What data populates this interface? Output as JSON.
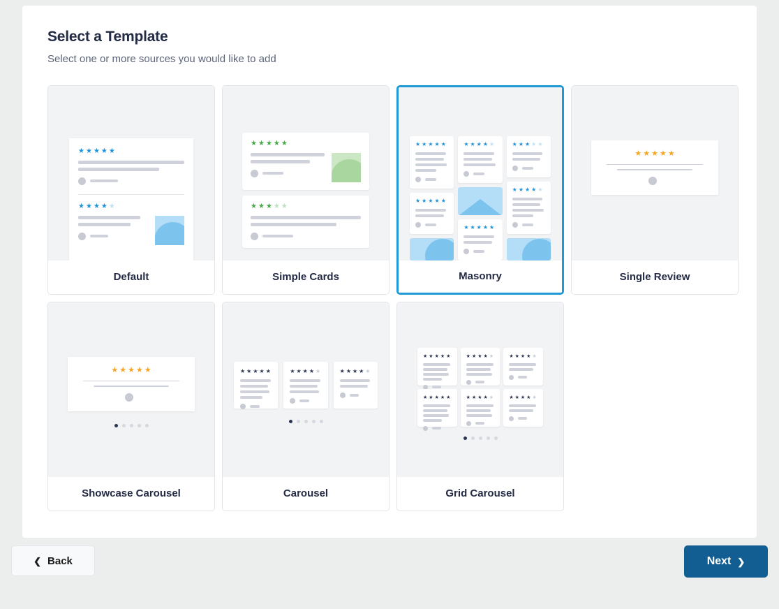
{
  "header": {
    "title": "Select a Template",
    "subtitle": "Select one or more sources you would like to add"
  },
  "colors": {
    "page_background": "#eceded",
    "panel_background": "#ffffff",
    "selected_border": "#1f9ad6",
    "title_text": "#232b45",
    "subtitle_text": "#5b6479",
    "star_blue": "#1f93d8",
    "star_blue_empty": "#bfe2f5",
    "star_green": "#46a846",
    "star_green_empty": "#bfe0bf",
    "star_gold": "#f5a623",
    "star_navy": "#2b3450",
    "star_navy_empty": "#c9ccd4",
    "skeleton_line": "#cfd2da",
    "preview_background": "#f2f3f5",
    "image_blue": "#b4ddf7",
    "image_blue_dark": "#7cc4ee",
    "image_green": "#cbe7c4",
    "image_green_dark": "#a9d69f",
    "next_button": "#125e92",
    "back_button": "#f8f9fa"
  },
  "templates": [
    {
      "id": "default",
      "label": "Default",
      "selected": false,
      "preview": {
        "style": "default",
        "star_color": "blue",
        "reviews": [
          {
            "rating": 5,
            "max": 5,
            "lines": 2,
            "has_image": false
          },
          {
            "rating": 4,
            "max": 5,
            "lines": 2,
            "has_image": true
          }
        ]
      }
    },
    {
      "id": "simple-cards",
      "label": "Simple Cards",
      "selected": false,
      "preview": {
        "style": "simple-cards",
        "star_color": "green",
        "reviews": [
          {
            "rating": 5,
            "max": 5,
            "lines": 2,
            "has_image": true
          },
          {
            "rating": 3,
            "max": 5,
            "lines": 2,
            "has_image": false
          }
        ]
      }
    },
    {
      "id": "masonry",
      "label": "Masonry",
      "selected": true,
      "preview": {
        "style": "masonry",
        "star_color": "blue",
        "columns": [
          [
            {
              "type": "review",
              "rating": 5,
              "max": 5,
              "lines": 4
            },
            {
              "type": "review",
              "rating": 5,
              "max": 5,
              "lines": 2
            },
            {
              "type": "image",
              "shape": "arc"
            }
          ],
          [
            {
              "type": "review",
              "rating": 4,
              "max": 5,
              "lines": 3
            },
            {
              "type": "image",
              "shape": "mountain"
            },
            {
              "type": "review",
              "rating": 5,
              "max": 5,
              "lines": 2
            }
          ],
          [
            {
              "type": "review",
              "rating": 3,
              "max": 5,
              "lines": 2
            },
            {
              "type": "review",
              "rating": 4,
              "max": 5,
              "lines": 4
            },
            {
              "type": "image",
              "shape": "arc"
            }
          ]
        ]
      }
    },
    {
      "id": "single-review",
      "label": "Single Review",
      "selected": false,
      "preview": {
        "style": "single-review",
        "star_color": "gold",
        "reviews": [
          {
            "rating": 5,
            "max": 5,
            "lines": 2,
            "has_image": false
          }
        ]
      }
    },
    {
      "id": "showcase-carousel",
      "label": "Showcase Carousel",
      "selected": false,
      "preview": {
        "style": "showcase-carousel",
        "star_color": "gold",
        "reviews": [
          {
            "rating": 5,
            "max": 5,
            "lines": 2,
            "has_image": false
          }
        ],
        "dots": {
          "count": 5,
          "active_index": 0
        }
      }
    },
    {
      "id": "carousel",
      "label": "Carousel",
      "selected": false,
      "preview": {
        "style": "carousel",
        "star_color": "navy",
        "cards": [
          {
            "rating": 5,
            "max": 5,
            "lines": 4
          },
          {
            "rating": 4,
            "max": 5,
            "lines": 3
          },
          {
            "rating": 4,
            "max": 5,
            "lines": 2
          }
        ],
        "dots": {
          "count": 5,
          "active_index": 0
        }
      }
    },
    {
      "id": "grid-carousel",
      "label": "Grid Carousel",
      "selected": false,
      "preview": {
        "style": "grid-carousel",
        "star_color": "navy",
        "cards": [
          {
            "rating": 5,
            "max": 5,
            "lines": 4
          },
          {
            "rating": 4,
            "max": 5,
            "lines": 3
          },
          {
            "rating": 4,
            "max": 5,
            "lines": 2
          },
          {
            "rating": 5,
            "max": 5,
            "lines": 4
          },
          {
            "rating": 4,
            "max": 5,
            "lines": 3
          },
          {
            "rating": 4,
            "max": 5,
            "lines": 2
          }
        ],
        "dots": {
          "count": 5,
          "active_index": 0
        }
      }
    }
  ],
  "footer": {
    "back_label": "Back",
    "back_icon": "chevron-left-icon",
    "next_label": "Next",
    "next_icon": "chevron-right-icon"
  }
}
